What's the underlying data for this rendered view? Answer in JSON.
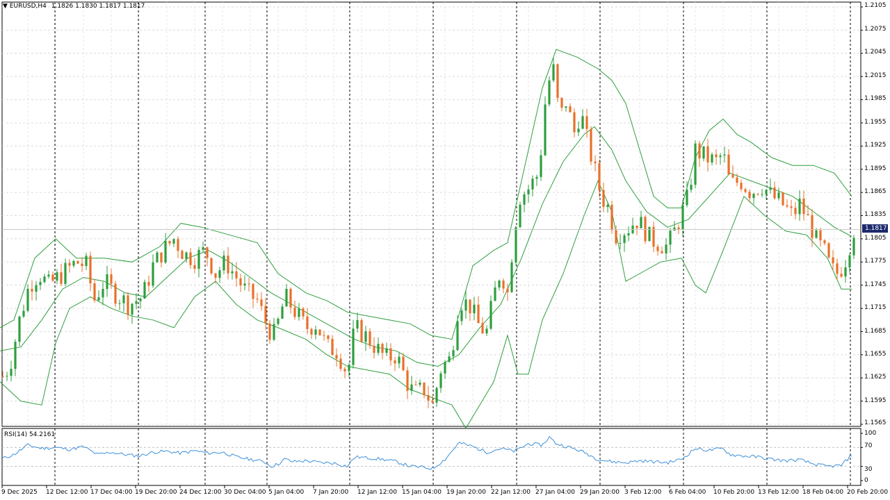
{
  "header": {
    "dropdown_icon": "triangle-down-icon",
    "symbol": "EURUSD,H4",
    "ohlc": "1.1826 1.1830 1.1817 1.1817"
  },
  "price_marker": "1.1817",
  "rsi": {
    "title": "RSI(14) 54.2161"
  },
  "price_axis": [
    "1.2105",
    "1.2075",
    "1.2045",
    "1.2015",
    "1.1985",
    "1.1955",
    "1.1925",
    "1.1895",
    "1.1865",
    "1.1835",
    "1.1805",
    "1.1775",
    "1.1745",
    "1.1715",
    "1.1685",
    "1.1655",
    "1.1625",
    "1.1595",
    "1.1565"
  ],
  "rsi_axis": [
    "100",
    "70",
    "30",
    "0"
  ],
  "time_axis": [
    "9 Dec 2025",
    "12 Dec 12:00",
    "17 Dec 04:00",
    "19 Dec 20:00",
    "24 Dec 12:00",
    "30 Dec 04:00",
    "5 Jan 04:00",
    "7 Jan 20:00",
    "12 Jan 12:00",
    "15 Jan 04:00",
    "19 Jan 20:00",
    "22 Jan 12:00",
    "27 Jan 04:00",
    "29 Jan 20:00",
    "3 Feb 12:00",
    "6 Feb 04:00",
    "10 Feb 20:00",
    "13 Feb 12:00",
    "18 Feb 04:00",
    "20 Feb 20:00"
  ],
  "colors": {
    "bull": "#2e9e3e",
    "bear": "#e8702a",
    "bands": "#2e9e3e",
    "rsi": "#3c8fd8",
    "marker": "#1c2a6c"
  },
  "chart_data": {
    "type": "candlestick",
    "symbol": "EURUSD",
    "timeframe": "H4",
    "ylim": [
      1.1565,
      1.2105
    ],
    "close_path": [
      [
        0,
        1.1622
      ],
      [
        14,
        1.164
      ],
      [
        28,
        1.17
      ],
      [
        42,
        1.1745
      ],
      [
        56,
        1.176
      ],
      [
        70,
        1.1745
      ],
      [
        90,
        1.176
      ],
      [
        110,
        1.1775
      ],
      [
        125,
        1.177
      ],
      [
        135,
        1.1725
      ],
      [
        150,
        1.175
      ],
      [
        165,
        1.1735
      ],
      [
        185,
        1.172
      ],
      [
        205,
        1.173
      ],
      [
        220,
        1.177
      ],
      [
        235,
        1.179
      ],
      [
        250,
        1.1805
      ],
      [
        265,
        1.1785
      ],
      [
        280,
        1.178
      ],
      [
        295,
        1.179
      ],
      [
        310,
        1.176
      ],
      [
        325,
        1.1775
      ],
      [
        340,
        1.1755
      ],
      [
        355,
        1.1735
      ],
      [
        370,
        1.1725
      ],
      [
        385,
        1.169
      ],
      [
        395,
        1.168
      ],
      [
        410,
        1.173
      ],
      [
        425,
        1.171
      ],
      [
        440,
        1.169
      ],
      [
        455,
        1.1695
      ],
      [
        470,
        1.1665
      ],
      [
        485,
        1.166
      ],
      [
        500,
        1.163
      ],
      [
        510,
        1.169
      ],
      [
        525,
        1.168
      ],
      [
        540,
        1.1665
      ],
      [
        555,
        1.165
      ],
      [
        570,
        1.1655
      ],
      [
        585,
        1.162
      ],
      [
        595,
        1.1605
      ],
      [
        610,
        1.161
      ],
      [
        622,
        1.159
      ],
      [
        635,
        1.164
      ],
      [
        648,
        1.165
      ],
      [
        660,
        1.1725
      ],
      [
        675,
        1.172
      ],
      [
        690,
        1.169
      ],
      [
        700,
        1.1685
      ],
      [
        710,
        1.173
      ],
      [
        720,
        1.1765
      ],
      [
        730,
        1.1735
      ],
      [
        740,
        1.182
      ],
      [
        748,
        1.186
      ],
      [
        760,
        1.187
      ],
      [
        775,
        1.189
      ],
      [
        785,
        1.199
      ],
      [
        795,
        1.203
      ],
      [
        805,
        1.196
      ],
      [
        815,
        1.1985
      ],
      [
        825,
        1.194
      ],
      [
        835,
        1.197
      ],
      [
        845,
        1.193
      ],
      [
        855,
        1.1895
      ],
      [
        865,
        1.186
      ],
      [
        875,
        1.1845
      ],
      [
        885,
        1.181
      ],
      [
        895,
        1.1815
      ],
      [
        905,
        1.182
      ],
      [
        915,
        1.183
      ],
      [
        925,
        1.182
      ],
      [
        935,
        1.1805
      ],
      [
        945,
        1.18
      ],
      [
        960,
        1.1795
      ],
      [
        975,
        1.1825
      ],
      [
        990,
        1.186
      ],
      [
        1000,
        1.192
      ],
      [
        1015,
        1.191
      ],
      [
        1030,
        1.1905
      ],
      [
        1040,
        1.1915
      ],
      [
        1050,
        1.1875
      ],
      [
        1065,
        1.188
      ],
      [
        1080,
        1.1865
      ],
      [
        1095,
        1.1875
      ],
      [
        1110,
        1.186
      ],
      [
        1125,
        1.185
      ],
      [
        1140,
        1.1835
      ],
      [
        1150,
        1.185
      ],
      [
        1165,
        1.1825
      ],
      [
        1175,
        1.18
      ],
      [
        1185,
        1.179
      ],
      [
        1195,
        1.1765
      ],
      [
        1205,
        1.176
      ],
      [
        1215,
        1.1775
      ],
      [
        1228,
        1.1817
      ]
    ],
    "bollinger_middle": [
      [
        0,
        1.166
      ],
      [
        30,
        1.1665
      ],
      [
        60,
        1.17
      ],
      [
        90,
        1.174
      ],
      [
        120,
        1.1755
      ],
      [
        150,
        1.175
      ],
      [
        180,
        1.1735
      ],
      [
        210,
        1.173
      ],
      [
        240,
        1.1755
      ],
      [
        270,
        1.178
      ],
      [
        300,
        1.179
      ],
      [
        330,
        1.1775
      ],
      [
        360,
        1.1755
      ],
      [
        390,
        1.1735
      ],
      [
        420,
        1.172
      ],
      [
        450,
        1.1705
      ],
      [
        480,
        1.169
      ],
      [
        510,
        1.1675
      ],
      [
        540,
        1.1665
      ],
      [
        570,
        1.166
      ],
      [
        600,
        1.1645
      ],
      [
        630,
        1.164
      ],
      [
        660,
        1.1655
      ],
      [
        690,
        1.169
      ],
      [
        720,
        1.172
      ],
      [
        750,
        1.178
      ],
      [
        780,
        1.185
      ],
      [
        810,
        1.1905
      ],
      [
        840,
        1.194
      ],
      [
        855,
        1.195
      ],
      [
        880,
        1.192
      ],
      [
        900,
        1.188
      ],
      [
        930,
        1.184
      ],
      [
        960,
        1.182
      ],
      [
        990,
        1.183
      ],
      [
        1020,
        1.186
      ],
      [
        1050,
        1.189
      ],
      [
        1080,
        1.188
      ],
      [
        1110,
        1.187
      ],
      [
        1140,
        1.186
      ],
      [
        1170,
        1.184
      ],
      [
        1200,
        1.182
      ],
      [
        1225,
        1.1808
      ]
    ],
    "bollinger_upper": [
      [
        0,
        1.169
      ],
      [
        20,
        1.17
      ],
      [
        50,
        1.178
      ],
      [
        80,
        1.1805
      ],
      [
        110,
        1.178
      ],
      [
        150,
        1.178
      ],
      [
        190,
        1.1775
      ],
      [
        230,
        1.1795
      ],
      [
        260,
        1.1825
      ],
      [
        290,
        1.182
      ],
      [
        330,
        1.181
      ],
      [
        370,
        1.18
      ],
      [
        400,
        1.176
      ],
      [
        440,
        1.1735
      ],
      [
        470,
        1.1725
      ],
      [
        500,
        1.171
      ],
      [
        530,
        1.1705
      ],
      [
        560,
        1.17
      ],
      [
        590,
        1.1695
      ],
      [
        620,
        1.168
      ],
      [
        650,
        1.1675
      ],
      [
        680,
        1.177
      ],
      [
        710,
        1.179
      ],
      [
        730,
        1.18
      ],
      [
        750,
        1.188
      ],
      [
        780,
        1.2
      ],
      [
        800,
        1.205
      ],
      [
        830,
        1.204
      ],
      [
        860,
        1.2025
      ],
      [
        880,
        1.201
      ],
      [
        900,
        1.198
      ],
      [
        920,
        1.192
      ],
      [
        940,
        1.186
      ],
      [
        960,
        1.1845
      ],
      [
        980,
        1.1845
      ],
      [
        1000,
        1.191
      ],
      [
        1020,
        1.1945
      ],
      [
        1040,
        1.196
      ],
      [
        1060,
        1.194
      ],
      [
        1080,
        1.193
      ],
      [
        1110,
        1.191
      ],
      [
        1140,
        1.19
      ],
      [
        1170,
        1.19
      ],
      [
        1200,
        1.189
      ],
      [
        1225,
        1.186
      ]
    ],
    "bollinger_lower": [
      [
        0,
        1.162
      ],
      [
        30,
        1.1595
      ],
      [
        60,
        1.159
      ],
      [
        80,
        1.167
      ],
      [
        100,
        1.1715
      ],
      [
        130,
        1.173
      ],
      [
        160,
        1.1715
      ],
      [
        190,
        1.1705
      ],
      [
        220,
        1.17
      ],
      [
        250,
        1.169
      ],
      [
        280,
        1.173
      ],
      [
        310,
        1.175
      ],
      [
        340,
        1.172
      ],
      [
        370,
        1.17
      ],
      [
        400,
        1.169
      ],
      [
        440,
        1.1675
      ],
      [
        470,
        1.1655
      ],
      [
        500,
        1.164
      ],
      [
        530,
        1.1635
      ],
      [
        560,
        1.163
      ],
      [
        590,
        1.161
      ],
      [
        620,
        1.16
      ],
      [
        650,
        1.159
      ],
      [
        670,
        1.156
      ],
      [
        690,
        1.159
      ],
      [
        710,
        1.162
      ],
      [
        730,
        1.168
      ],
      [
        745,
        1.163
      ],
      [
        760,
        1.163
      ],
      [
        780,
        1.17
      ],
      [
        810,
        1.176
      ],
      [
        840,
        1.1835
      ],
      [
        860,
        1.188
      ],
      [
        880,
        1.184
      ],
      [
        900,
        1.175
      ],
      [
        920,
        1.176
      ],
      [
        950,
        1.1775
      ],
      [
        980,
        1.178
      ],
      [
        1000,
        1.1745
      ],
      [
        1015,
        1.1735
      ],
      [
        1040,
        1.179
      ],
      [
        1070,
        1.186
      ],
      [
        1100,
        1.1835
      ],
      [
        1130,
        1.1815
      ],
      [
        1160,
        1.181
      ],
      [
        1190,
        1.178
      ],
      [
        1210,
        1.174
      ],
      [
        1225,
        1.174
      ]
    ],
    "rsi": {
      "period": 14,
      "ylim": [
        0,
        100
      ],
      "levels": [
        30,
        70
      ],
      "last": 54.2161,
      "values": [
        [
          0,
          45
        ],
        [
          20,
          55
        ],
        [
          40,
          75
        ],
        [
          60,
          68
        ],
        [
          80,
          70
        ],
        [
          100,
          66
        ],
        [
          120,
          72
        ],
        [
          140,
          55
        ],
        [
          160,
          60
        ],
        [
          180,
          55
        ],
        [
          200,
          52
        ],
        [
          220,
          60
        ],
        [
          240,
          62
        ],
        [
          260,
          58
        ],
        [
          280,
          63
        ],
        [
          300,
          58
        ],
        [
          320,
          60
        ],
        [
          340,
          50
        ],
        [
          360,
          45
        ],
        [
          380,
          40
        ],
        [
          390,
          30
        ],
        [
          400,
          35
        ],
        [
          410,
          46
        ],
        [
          420,
          40
        ],
        [
          440,
          42
        ],
        [
          460,
          38
        ],
        [
          480,
          37
        ],
        [
          500,
          30
        ],
        [
          510,
          50
        ],
        [
          530,
          48
        ],
        [
          550,
          45
        ],
        [
          570,
          40
        ],
        [
          590,
          30
        ],
        [
          610,
          28
        ],
        [
          622,
          25
        ],
        [
          640,
          45
        ],
        [
          660,
          80
        ],
        [
          680,
          72
        ],
        [
          700,
          60
        ],
        [
          720,
          68
        ],
        [
          740,
          62
        ],
        [
          760,
          78
        ],
        [
          780,
          75
        ],
        [
          790,
          92
        ],
        [
          800,
          78
        ],
        [
          820,
          70
        ],
        [
          840,
          60
        ],
        [
          860,
          45
        ],
        [
          880,
          40
        ],
        [
          900,
          38
        ],
        [
          920,
          42
        ],
        [
          940,
          40
        ],
        [
          960,
          38
        ],
        [
          980,
          45
        ],
        [
          1000,
          68
        ],
        [
          1020,
          64
        ],
        [
          1040,
          68
        ],
        [
          1050,
          55
        ],
        [
          1070,
          52
        ],
        [
          1090,
          50
        ],
        [
          1110,
          45
        ],
        [
          1130,
          42
        ],
        [
          1150,
          44
        ],
        [
          1170,
          35
        ],
        [
          1190,
          30
        ],
        [
          1210,
          32
        ],
        [
          1225,
          54
        ]
      ]
    }
  }
}
